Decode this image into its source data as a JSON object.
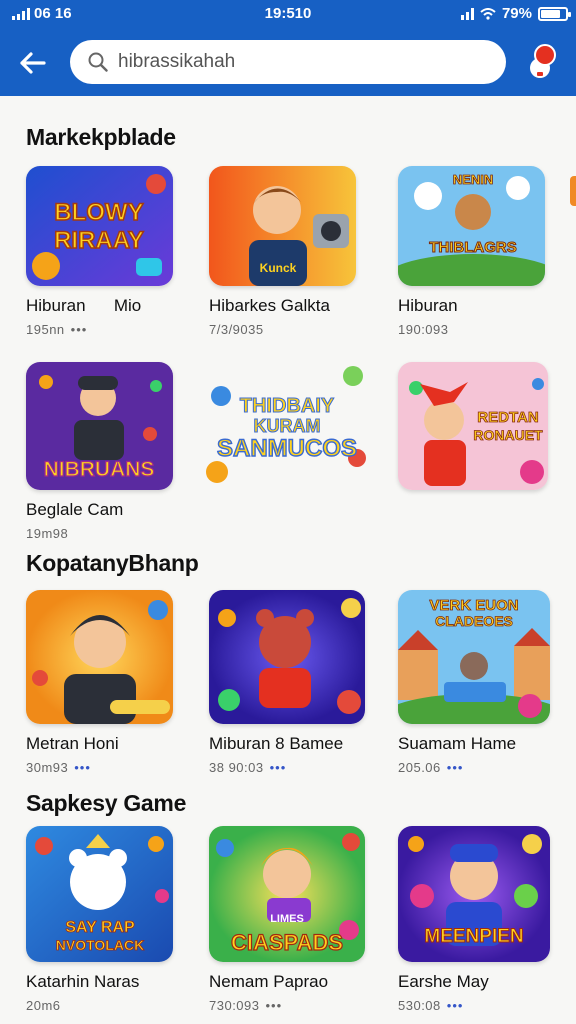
{
  "status_bar": {
    "left_text": "06 16",
    "time": "19:510",
    "battery_text": "79%",
    "battery_level": 0.79
  },
  "search": {
    "value": "hibrassikahah"
  },
  "sections": [
    {
      "title": "Markekpblade",
      "cards": [
        {
          "name": "Hiburan      Mio",
          "meta": "195nn",
          "dots": "gray",
          "art_text": [
            "BLOWY",
            "RIRAAY"
          ],
          "accent": "#2a62d8"
        },
        {
          "name": "Hibarkes Galkta",
          "meta": "7/3/9035",
          "dots": "",
          "art_text": [
            "Kunck"
          ],
          "accent": "#f07a20"
        },
        {
          "name": "Hiburan",
          "meta": "190:093",
          "dots": "",
          "art_text": [
            "NENIN",
            "THIBLAGRS"
          ],
          "accent": "#4aa3e8"
        },
        {
          "name": "Beglale Cam",
          "meta": "19m98",
          "dots": "gray",
          "art_text": [
            "NIBRUANS"
          ],
          "accent": "#6a2aa8"
        },
        {
          "name": "",
          "meta": "",
          "dots": "",
          "art_text": [
            "THIDBAIY",
            "KURAM",
            "SANMUCOS"
          ],
          "accent": "#ffffff"
        },
        {
          "name": "",
          "meta": "",
          "dots": "",
          "art_text": [
            "REDTAN",
            "RONAUET"
          ],
          "accent": "#f2b6c8"
        }
      ]
    },
    {
      "title": "KopatanyBhanp",
      "cards": [
        {
          "name": "Metran Honi",
          "meta": "30m93",
          "dots": "blue",
          "art_text": [],
          "accent": "#f5a318"
        },
        {
          "name": "Miburan 8 Bamee",
          "meta": "38 90:03",
          "dots": "blue",
          "art_text": [],
          "accent": "#4a3ad0"
        },
        {
          "name": "Suamam Hame",
          "meta": "205.06",
          "dots": "blue",
          "art_text": [
            "VERK EUON",
            "CLADEOES"
          ],
          "accent": "#58a8e6"
        }
      ]
    },
    {
      "title": "Sapkesy Game",
      "cards": [
        {
          "name": "Katarhin Naras",
          "meta": "20m6",
          "dots": "",
          "art_text": [
            "SAY RAP",
            "NVOTOLACK"
          ],
          "accent": "#2f8ae0"
        },
        {
          "name": "Nemam Paprao",
          "meta": "730:093",
          "dots": "gray",
          "art_text": [
            "LIMES",
            "CIASPADS"
          ],
          "accent": "#f2a01c"
        },
        {
          "name": "Earshe May",
          "meta": "530:08",
          "dots": "blue",
          "art_text": [
            "MEENPIEN"
          ],
          "accent": "#5b2fc4"
        }
      ]
    }
  ],
  "icons": {
    "back": "arrow-left-icon",
    "search": "search-icon",
    "notification": "notification-icon"
  },
  "colors": {
    "app_bar": "#1760c4",
    "badge": "#e43020",
    "dots_blue": "#3556c8"
  }
}
